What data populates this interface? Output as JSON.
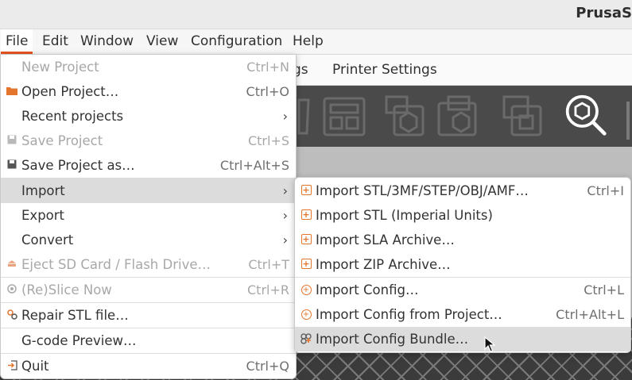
{
  "window": {
    "title": "PrusaS"
  },
  "menubar": [
    "File",
    "Edit",
    "Window",
    "View",
    "Configuration",
    "Help"
  ],
  "tabs": {
    "partial": "gs",
    "printer_settings": "Printer Settings"
  },
  "file_menu": {
    "items": [
      {
        "label": "New Project",
        "shortcut": "Ctrl+N",
        "icon": "",
        "disabled": true
      },
      {
        "label": "Open Project…",
        "shortcut": "Ctrl+O",
        "icon": "folder-icon",
        "disabled": false
      },
      {
        "label": "Recent projects",
        "shortcut": "",
        "icon": "",
        "submenu": true
      },
      {
        "label": "Save Project",
        "shortcut": "Ctrl+S",
        "icon": "save-icon",
        "disabled": true
      },
      {
        "label": "Save Project as…",
        "shortcut": "Ctrl+Alt+S",
        "icon": "save-icon",
        "disabled": false
      },
      {
        "label": "Import",
        "shortcut": "",
        "icon": "",
        "submenu": true,
        "highlighted": true
      },
      {
        "label": "Export",
        "shortcut": "",
        "icon": "",
        "submenu": true
      },
      {
        "label": "Convert",
        "shortcut": "",
        "icon": "",
        "submenu": true
      },
      {
        "label": "Eject SD Card / Flash Drive…",
        "shortcut": "Ctrl+T",
        "icon": "eject-icon",
        "disabled": true
      },
      {
        "label": "(Re)Slice Now",
        "shortcut": "Ctrl+R",
        "icon": "slice-icon",
        "disabled": true
      },
      {
        "label": "Repair STL file…",
        "shortcut": "",
        "icon": "repair-icon",
        "disabled": false
      },
      {
        "label": "G-code Preview…",
        "shortcut": "",
        "icon": "",
        "disabled": false
      },
      {
        "label": "Quit",
        "shortcut": "Ctrl+Q",
        "icon": "exit-icon",
        "disabled": false
      }
    ]
  },
  "import_menu": {
    "items": [
      {
        "label": "Import STL/3MF/STEP/OBJ/AMF…",
        "shortcut": "Ctrl+I",
        "icon": "import-plus-icon"
      },
      {
        "label": "Import STL (Imperial Units)",
        "shortcut": "",
        "icon": "import-plus-icon"
      },
      {
        "label": "Import SLA Archive…",
        "shortcut": "",
        "icon": "import-plus-icon"
      },
      {
        "label": "Import ZIP Archive…",
        "shortcut": "",
        "icon": "import-plus-icon"
      },
      {
        "label": "Import Config…",
        "shortcut": "Ctrl+L",
        "icon": "import-config-icon"
      },
      {
        "label": "Import Config from Project…",
        "shortcut": "Ctrl+Alt+L",
        "icon": "import-config-icon"
      },
      {
        "label": "Import Config Bundle…",
        "shortcut": "",
        "icon": "import-bundle-icon",
        "highlighted": true
      }
    ]
  },
  "colors": {
    "accent": "#e95420",
    "icon_orange": "#e3752c",
    "toolbar_bg": "#4a4a4a"
  }
}
